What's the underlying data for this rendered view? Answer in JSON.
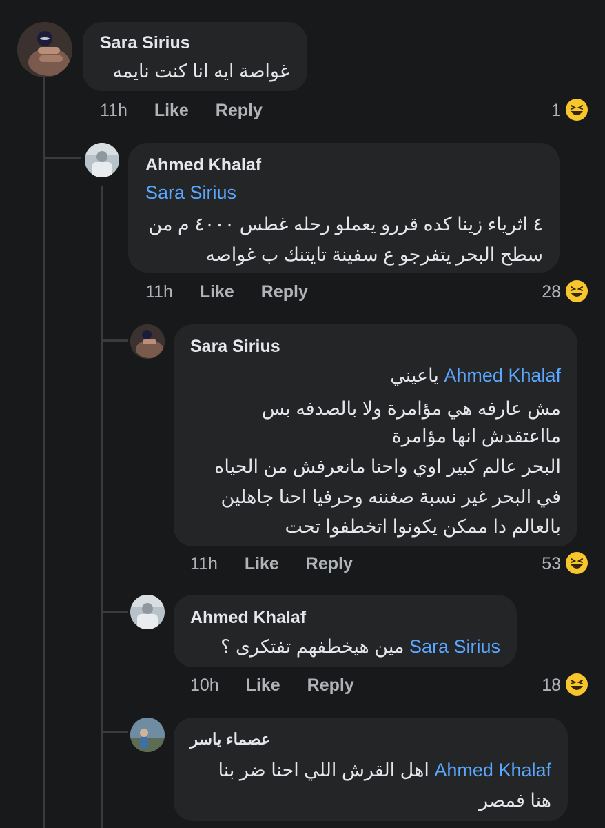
{
  "comments": [
    {
      "author": "Sara Sirius",
      "lines": [
        "غواصة ايه انا كنت نايمه"
      ],
      "time": "11h",
      "like": "Like",
      "reply": "Reply",
      "reactions": "1",
      "reaction_icon": "laughing-emoji-icon"
    },
    {
      "author": "Ahmed Khalaf",
      "mention": "Sara Sirius",
      "lines": [
        "٤ اثرياء زينا كده قررو يعملو رحله غطس ٤٠٠٠ م من",
        "سطح البحر يتفرجو ع سفينة تايتنك ب غواصه"
      ],
      "time": "11h",
      "like": "Like",
      "reply": "Reply",
      "reactions": "28",
      "reaction_icon": "laughing-emoji-icon"
    },
    {
      "author": "Sara Sirius",
      "mention": "Ahmed Khalaf",
      "mention_suffix": "ياعيني",
      "lines": [
        "مش عارفه هي مؤامرة ولا بالصدفه بس",
        "مااعتقدش انها مؤامرة",
        "البحر عالم كبير اوي واحنا مانعرفش من الحياه",
        "في البحر غير نسبة صغننه وحرفيا احنا جاهلين",
        "بالعالم دا ممكن يكونوا اتخطفوا تحت"
      ],
      "time": "11h",
      "like": "Like",
      "reply": "Reply",
      "reactions": "53",
      "reaction_icon": "laughing-emoji-icon"
    },
    {
      "author": "Ahmed Khalaf",
      "mention": "Sara Sirius",
      "mention_suffix": "مين هيخطفهم تفتكرى ؟",
      "time": "10h",
      "like": "Like",
      "reply": "Reply",
      "reactions": "18",
      "reaction_icon": "laughing-emoji-icon"
    },
    {
      "author": "عصماء ياسر",
      "mention": "Ahmed Khalaf",
      "mention_suffix": "اهل القرش اللي احنا ضر بنا",
      "lines": [
        "هنا فمصر"
      ]
    }
  ],
  "colors": {
    "background": "#18191b",
    "bubble": "#242526",
    "mention": "#5aa7ff",
    "meta": "#b0b3b8",
    "emoji": "#f7c52c"
  }
}
